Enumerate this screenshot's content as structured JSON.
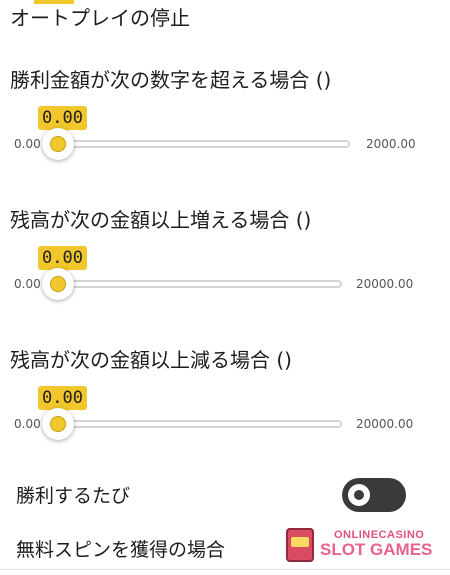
{
  "title": "オートプレイの停止",
  "sliders": [
    {
      "label": "勝利金額が次の数字を超える場合 ()",
      "value": "0.00",
      "min": "0.00",
      "max": "2000.00"
    },
    {
      "label": "残高が次の金額以上増える場合 ()",
      "value": "0.00",
      "min": "0.00",
      "max": "20000.00"
    },
    {
      "label": "残高が次の金額以上減る場合 ()",
      "value": "0.00",
      "min": "0.00",
      "max": "20000.00"
    }
  ],
  "toggles": [
    {
      "label": "勝利するたび",
      "state": "off"
    }
  ],
  "last_option_label": "無料スピンを獲得の場合",
  "watermark": {
    "line1": "ONLINECASINO",
    "line2": "SLOT GAMES",
    "icon": "slot-machine-icon"
  },
  "colors": {
    "accent": "#f2c72c",
    "toggle_off": "#3a3a3a",
    "track": "#d4d4d4"
  }
}
